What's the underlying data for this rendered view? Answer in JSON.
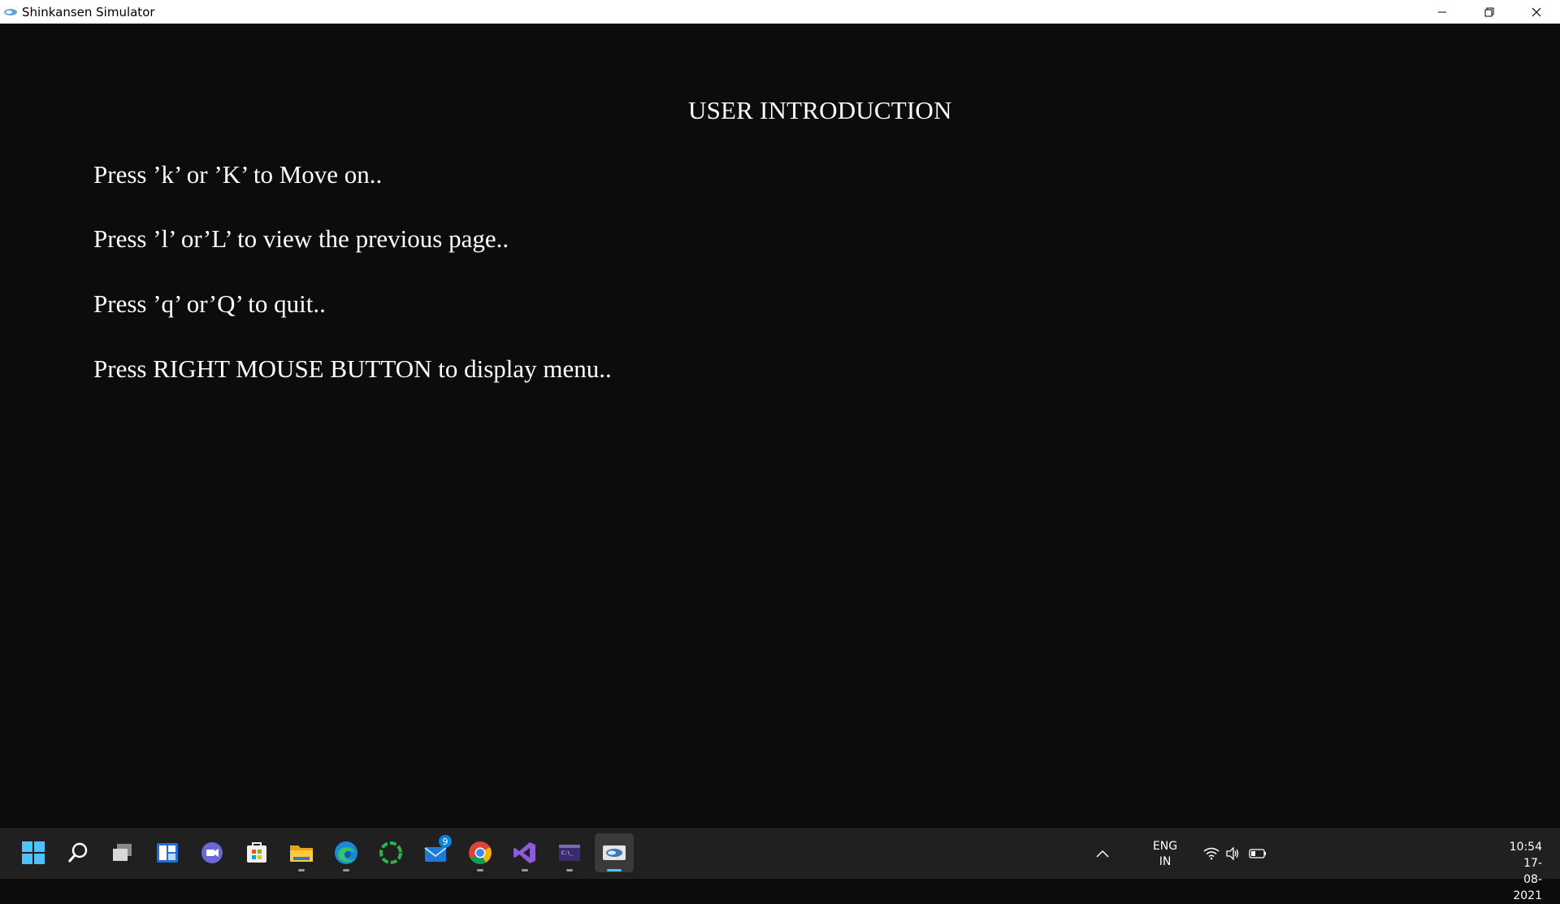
{
  "window": {
    "title": "Shinkansen Simulator"
  },
  "content": {
    "heading": "USER INTRODUCTION",
    "lines": [
      "Press ’k’ or ’K’ to Move on..",
      "Press ’l’ or’L’ to view the previous page..",
      "Press ’q’ or’Q’ to quit..",
      "Press RIGHT MOUSE BUTTON to display menu.."
    ]
  },
  "taskbar": {
    "apps": [
      {
        "name": "start-icon"
      },
      {
        "name": "search-icon"
      },
      {
        "name": "task-view-icon"
      },
      {
        "name": "widgets-icon"
      },
      {
        "name": "teams-chat-icon"
      },
      {
        "name": "microsoft-store-icon"
      },
      {
        "name": "file-explorer-icon",
        "running": true
      },
      {
        "name": "edge-icon",
        "running": true
      },
      {
        "name": "loader-app-icon"
      },
      {
        "name": "mail-icon",
        "badge": "9"
      },
      {
        "name": "chrome-icon",
        "running": true
      },
      {
        "name": "visual-studio-icon",
        "running": true
      },
      {
        "name": "terminal-icon",
        "running": true
      },
      {
        "name": "opengl-app-icon",
        "running": true,
        "active": true
      }
    ],
    "language": {
      "line1": "ENG",
      "line2": "IN"
    },
    "clock": {
      "time": "10:54",
      "date": "17-08-2021"
    }
  },
  "colors": {
    "background": "#0c0c0c",
    "taskbar": "#202020",
    "accent": "#4cc2ff"
  }
}
